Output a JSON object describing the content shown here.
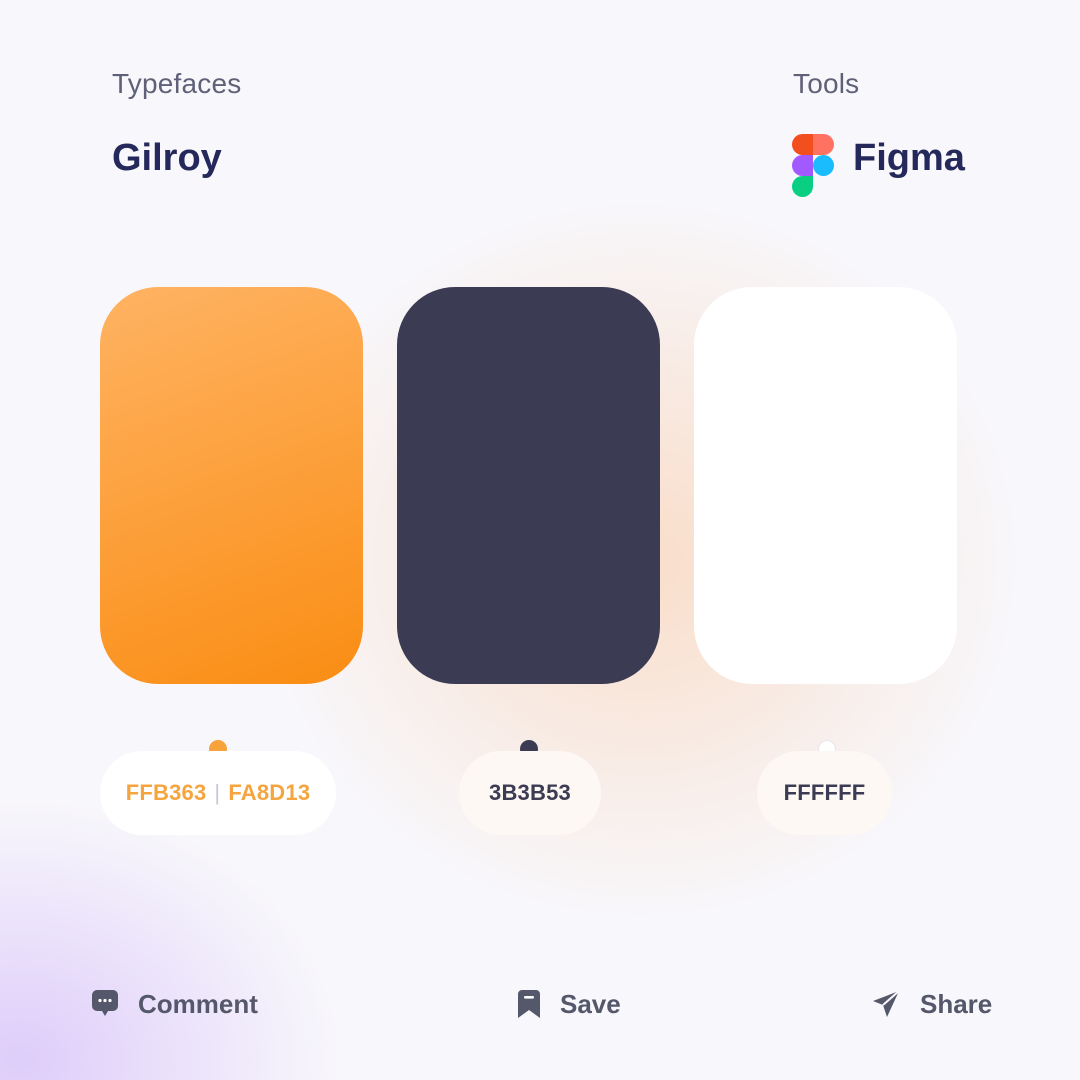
{
  "typefaces": {
    "label": "Typefaces",
    "name": "Gilroy"
  },
  "tools": {
    "label": "Tools",
    "name": "Figma",
    "icon": "figma-logo-icon"
  },
  "palette": [
    {
      "code_parts": [
        "FFB363",
        "FA8D13"
      ],
      "separator": "|",
      "colors": [
        "#FFB363",
        "#FA8D13"
      ]
    },
    {
      "code": "3B3B53",
      "color": "#3B3B53"
    },
    {
      "code": "FFFFFF",
      "color": "#FFFFFF"
    }
  ],
  "actions": {
    "comment": {
      "label": "Comment",
      "icon": "comment-icon"
    },
    "save": {
      "label": "Save",
      "icon": "bookmark-icon"
    },
    "share": {
      "label": "Share",
      "icon": "send-icon"
    }
  },
  "colors": {
    "headline": "#25285A",
    "label": "#5F6178",
    "action": "#55576A",
    "orange_text": "#F5A43E",
    "dark_text": "#3B3B53"
  }
}
